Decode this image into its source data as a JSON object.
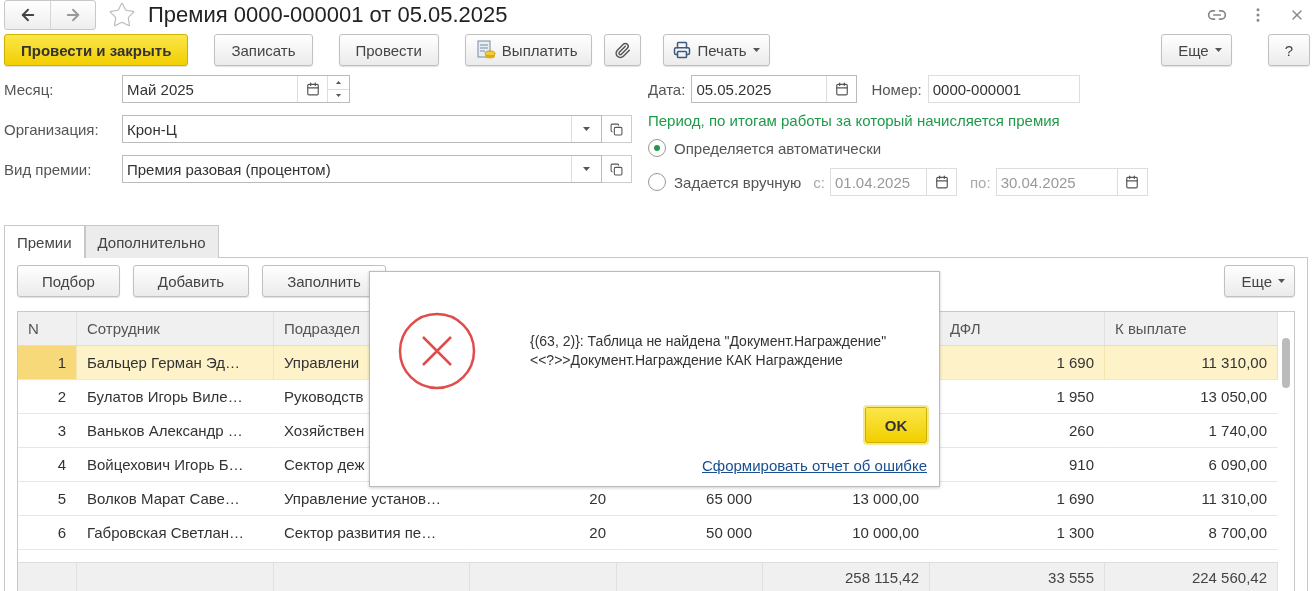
{
  "window": {
    "title": "Премия 0000-000001 от 05.05.2025"
  },
  "toolbar": {
    "left": [
      {
        "kind": "primary",
        "label": "Провести и закрыть"
      },
      {
        "kind": "plain",
        "label": "Записать"
      },
      {
        "kind": "plain",
        "label": "Провести"
      },
      {
        "kind": "pay",
        "label": "Выплатить"
      },
      {
        "kind": "attach"
      },
      {
        "kind": "print",
        "label": "Печать"
      }
    ],
    "right": [
      {
        "kind": "menu",
        "label": "Еще"
      },
      {
        "kind": "plain",
        "label": "?"
      }
    ]
  },
  "form": {
    "month": {
      "label": "Месяц:",
      "value": "Май 2025"
    },
    "organization": {
      "label": "Организация:",
      "value": "Крон-Ц"
    },
    "bonus_type": {
      "label": "Вид премии:",
      "value": "Премия разовая (процентом)"
    },
    "date": {
      "label": "Дата:",
      "value": "05.05.2025"
    },
    "number": {
      "label": "Номер:",
      "value": "0000-000001"
    },
    "period": {
      "heading": "Период, по итогам работы за который начисляется премия",
      "options": [
        {
          "label": "Определяется автоматически",
          "selected": true
        },
        {
          "label": "Задается вручную",
          "selected": false
        }
      ],
      "range": {
        "disabled": true,
        "from_label": "с:",
        "from_value": "01.04.2025",
        "to_label": "по:",
        "to_value": "30.04.2025"
      }
    }
  },
  "tabs": [
    {
      "label": "Премии",
      "selected": true
    },
    {
      "label": "Дополнительно",
      "selected": false
    }
  ],
  "table_toolbar": {
    "buttons": [
      "Подбор",
      "Добавить",
      "Заполнить"
    ],
    "more": "Еще"
  },
  "table": {
    "columns": [
      "N",
      "Сотрудник",
      "Подраздел",
      null,
      null,
      null,
      "ДФЛ",
      "К выплате"
    ],
    "rows": [
      {
        "selected": true,
        "cells": [
          "1",
          "Бальцер Герман Эд…",
          "Управлени",
          null,
          null,
          null,
          "1 690",
          "11 310,00"
        ]
      },
      {
        "selected": false,
        "cells": [
          "2",
          "Булатов Игорь Виле…",
          "Руководств",
          null,
          null,
          null,
          "1 950",
          "13 050,00"
        ]
      },
      {
        "selected": false,
        "cells": [
          "3",
          "Ваньков Александр …",
          "Хозяйствен",
          null,
          null,
          null,
          "260",
          "1 740,00"
        ]
      },
      {
        "selected": false,
        "cells": [
          "4",
          "Войцехович Игорь Б…",
          "Сектор деж",
          null,
          null,
          null,
          "910",
          "6 090,00"
        ]
      },
      {
        "selected": false,
        "cells": [
          "5",
          "Волков Марат Саве…",
          "Управление установ…",
          "20",
          "65 000",
          "13 000,00",
          "1 690",
          "11 310,00"
        ]
      },
      {
        "selected": false,
        "cells": [
          "6",
          "Габровская Светлан…",
          "Сектор развития пе…",
          "20",
          "50 000",
          "10 000,00",
          "1 300",
          "8 700,00"
        ]
      }
    ],
    "totals": {
      "column_6": "258 115,42",
      "column_7": "33 555",
      "column_8": "224 560,42"
    }
  },
  "dialog": {
    "lines": [
      "{(63, 2)}: Таблица не найдена \"Документ.Награждение\"",
      "<<?>>Документ.Награждение КАК Награждение"
    ],
    "ok": "OK",
    "link": "Сформировать отчет об ошибке"
  }
}
